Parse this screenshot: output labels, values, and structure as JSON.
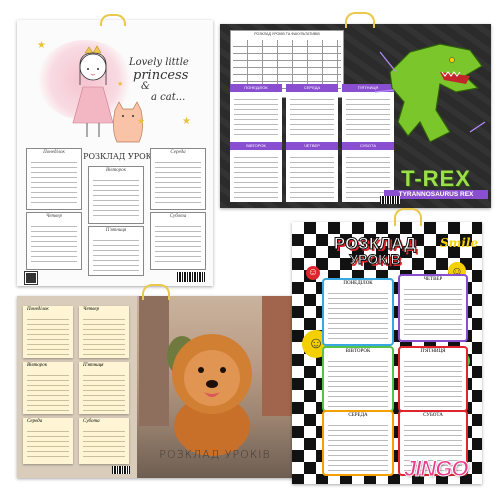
{
  "posters": {
    "princess": {
      "title_line1": "Lovely little",
      "title_line2": "princess",
      "title_line3": "&",
      "title_line4": "a cat...",
      "heading": "РОЗКЛАД УРОКІВ",
      "days": [
        "Понеділок",
        "Вівторок",
        "Середа",
        "Четвер",
        "П'ятниця",
        "Субота"
      ]
    },
    "dino": {
      "header_label": "РОЗКЛАД УРОКІВ ТА ФАКУЛЬТАТИВІВ",
      "days": [
        "ПОНЕДІЛОК",
        "СЕРЕДА",
        "П'ЯТНИЦЯ",
        "ВІВТОРОК",
        "ЧЕТВЕР",
        "СУБОТА"
      ],
      "name_big": "T-REX",
      "name_small": "TYRANNOSAURUS REX"
    },
    "dog": {
      "days": [
        "Понеділок",
        "Четвер",
        "Вівторок",
        "П'ятниця",
        "Середа",
        "Субота"
      ],
      "heading": "РОЗКЛАД УРОКІВ"
    },
    "smile": {
      "heading_line1": "Розклад",
      "heading_line2": "уроків",
      "brand": "Smile",
      "days": [
        "ПОНЕДІЛОК",
        "ЧЕТВЕР",
        "ВІВТОРОК",
        "П'ЯТНИЦЯ",
        "СЕРЕДА",
        "СУБОТА"
      ]
    }
  },
  "watermark": "JINGO",
  "colors": {
    "dino_bg": "#2b2b2b",
    "dino_accent": "#8a4fd0",
    "dino_green": "#7bc62a",
    "smile_red": "#e0262c",
    "smile_yellow": "#f5d000",
    "dog_fur": "#c8702a",
    "princess_pink": "#f3b7c4"
  }
}
